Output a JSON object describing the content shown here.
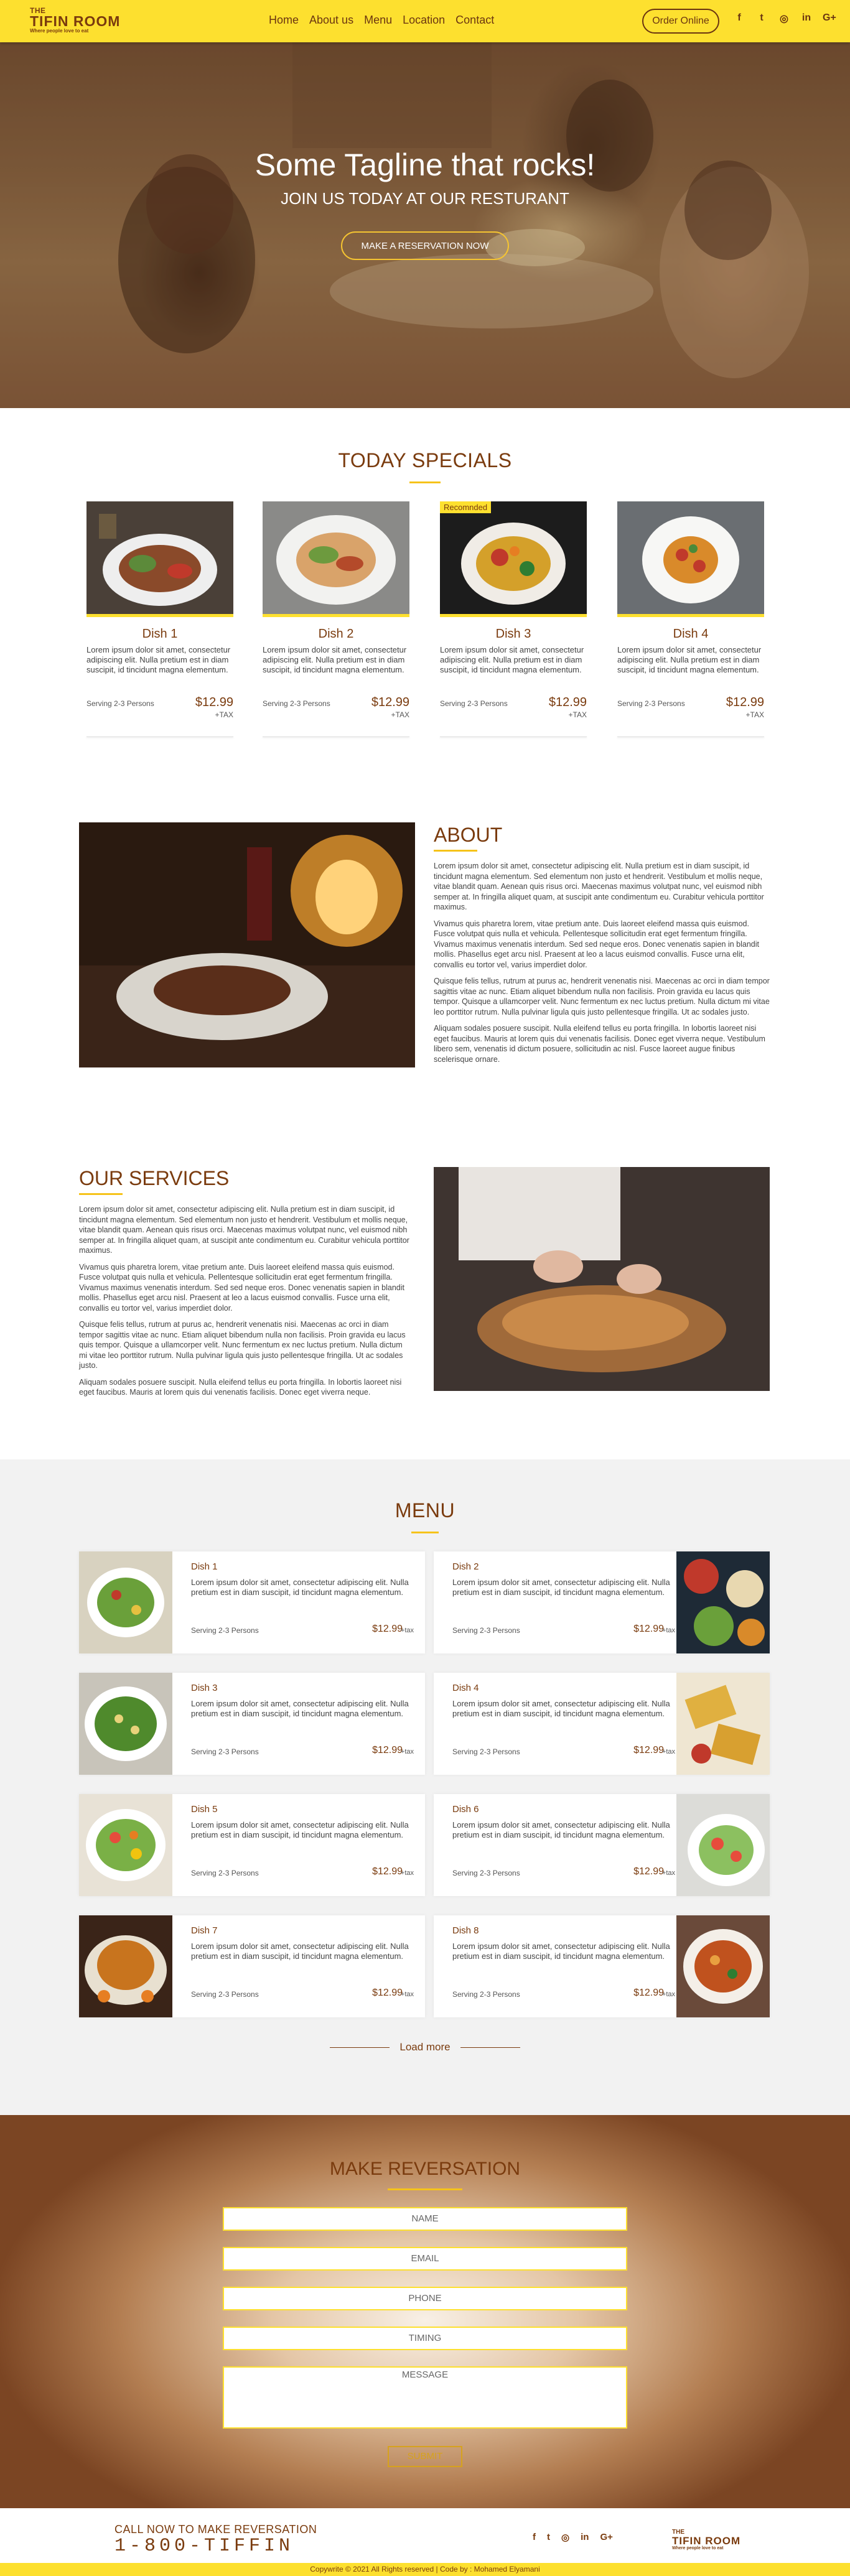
{
  "header": {
    "logo_top": "THE",
    "logo_main": "TIFIN ROOM",
    "logo_tagline": "Where people love to eat",
    "nav": [
      "Home",
      "About us",
      "Menu",
      "Location",
      "Contact"
    ],
    "order_button": "Order Online",
    "socials": [
      "f",
      "t",
      "◎",
      "in",
      "G+"
    ]
  },
  "hero": {
    "tagline": "Some Tagline that rocks!",
    "subline": "JOIN US TODAY AT OUR RESTURANT",
    "button": "MAKE A RESERVATION NOW"
  },
  "specials": {
    "title": "TODAY SPECIALS",
    "items": [
      {
        "name": "Dish 1",
        "desc": "Lorem ipsum dolor sit amet, consectetur adipiscing elit. Nulla pretium est in diam suscipit, id tincidunt magna elementum.",
        "serving": "Serving 2-3 Persons",
        "price": "$12.99",
        "tax": "+TAX"
      },
      {
        "name": "Dish 2",
        "desc": "Lorem ipsum dolor sit amet, consectetur adipiscing elit. Nulla pretium est in diam suscipit, id tincidunt magna elementum.",
        "serving": "Serving 2-3 Persons",
        "price": "$12.99",
        "tax": "+TAX"
      },
      {
        "name": "Dish 3",
        "desc": "Lorem ipsum dolor sit amet, consectetur adipiscing elit. Nulla pretium est in diam suscipit, id tincidunt magna elementum.",
        "serving": "Serving 2-3 Persons",
        "price": "$12.99",
        "tax": "+TAX",
        "badge": "Recomnded"
      },
      {
        "name": "Dish 4",
        "desc": "Lorem ipsum dolor sit amet, consectetur adipiscing elit. Nulla pretium est in diam suscipit, id tincidunt magna elementum.",
        "serving": "Serving 2-3 Persons",
        "price": "$12.99",
        "tax": "+TAX"
      }
    ]
  },
  "about": {
    "title": "ABOUT",
    "paragraphs": [
      "Lorem ipsum dolor sit amet, consectetur adipiscing elit. Nulla pretium est in diam suscipit, id tincidunt magna elementum. Sed elementum non justo et hendrerit. Vestibulum et mollis neque, vitae blandit quam. Aenean quis risus orci. Maecenas maximus volutpat nunc, vel euismod nibh semper at. In fringilla aliquet quam, at suscipit ante condimentum eu. Curabitur vehicula porttitor maximus.",
      "Vivamus quis pharetra lorem, vitae pretium ante. Duis laoreet eleifend massa quis euismod. Fusce volutpat quis nulla et vehicula. Pellentesque sollicitudin erat eget fermentum fringilla. Vivamus maximus venenatis interdum. Sed sed neque eros. Donec venenatis sapien in blandit mollis. Phasellus eget arcu nisl. Praesent at leo a lacus euismod convallis. Fusce urna elit, convallis eu tortor vel, varius imperdiet dolor.",
      "Quisque felis tellus, rutrum at purus ac, hendrerit venenatis nisi. Maecenas ac orci in diam tempor sagittis vitae ac nunc. Etiam aliquet bibendum nulla non facilisis. Proin gravida eu lacus quis tempor. Quisque a ullamcorper velit. Nunc fermentum ex nec luctus pretium. Nulla dictum mi vitae leo porttitor rutrum. Nulla pulvinar ligula quis justo pellentesque fringilla. Ut ac sodales justo.",
      "Aliquam sodales posuere suscipit. Nulla eleifend tellus eu porta fringilla. In lobortis laoreet nisi eget faucibus. Mauris at lorem quis dui venenatis facilisis. Donec eget viverra neque. Vestibulum libero sem, venenatis id dictum posuere, sollicitudin ac nisl. Fusce laoreet augue finibus scelerisque ornare."
    ]
  },
  "services": {
    "title": "OUR SERVICES",
    "paragraphs": [
      "Lorem ipsum dolor sit amet, consectetur adipiscing elit. Nulla pretium est in diam suscipit, id tincidunt magna elementum. Sed elementum non justo et hendrerit. Vestibulum et mollis neque, vitae blandit quam. Aenean quis risus orci. Maecenas maximus volutpat nunc, vel euismod nibh semper at. In fringilla aliquet quam, at suscipit ante condimentum eu. Curabitur vehicula porttitor maximus.",
      "Vivamus quis pharetra lorem, vitae pretium ante. Duis laoreet eleifend massa quis euismod. Fusce volutpat quis nulla et vehicula. Pellentesque sollicitudin erat eget fermentum fringilla. Vivamus maximus venenatis interdum. Sed sed neque eros. Donec venenatis sapien in blandit mollis. Phasellus eget arcu nisl. Praesent at leo a lacus euismod convallis. Fusce urna elit, convallis eu tortor vel, varius imperdiet dolor.",
      "Quisque felis tellus, rutrum at purus ac, hendrerit venenatis nisi. Maecenas ac orci in diam tempor sagittis vitae ac nunc. Etiam aliquet bibendum nulla non facilisis. Proin gravida eu lacus quis tempor. Quisque a ullamcorper velit. Nunc fermentum ex nec luctus pretium. Nulla dictum mi vitae leo porttitor rutrum. Nulla pulvinar ligula quis justo pellentesque fringilla. Ut ac sodales justo.",
      "Aliquam sodales posuere suscipit. Nulla eleifend tellus eu porta fringilla. In lobortis laoreet nisi eget faucibus. Mauris at lorem quis dui venenatis facilisis. Donec eget viverra neque."
    ]
  },
  "menu": {
    "title": "MENU",
    "items": [
      {
        "name": "Dish 1",
        "desc": "Lorem ipsum dolor sit amet, consectetur adipiscing elit. Nulla pretium est in diam suscipit, id tincidunt magna elementum.",
        "serving": "Serving 2-3 Persons",
        "price": "$12.99",
        "tax": "+tax"
      },
      {
        "name": "Dish 2",
        "desc": "Lorem ipsum dolor sit amet, consectetur adipiscing elit. Nulla pretium est in diam suscipit, id tincidunt magna elementum.",
        "serving": "Serving 2-3 Persons",
        "price": "$12.99",
        "tax": "+tax"
      },
      {
        "name": "Dish 3",
        "desc": "Lorem ipsum dolor sit amet, consectetur adipiscing elit. Nulla pretium est in diam suscipit, id tincidunt magna elementum.",
        "serving": "Serving 2-3 Persons",
        "price": "$12.99",
        "tax": "+tax"
      },
      {
        "name": "Dish 4",
        "desc": "Lorem ipsum dolor sit amet, consectetur adipiscing elit. Nulla pretium est in diam suscipit, id tincidunt magna elementum.",
        "serving": "Serving 2-3 Persons",
        "price": "$12.99",
        "tax": "+tax"
      },
      {
        "name": "Dish 5",
        "desc": "Lorem ipsum dolor sit amet, consectetur adipiscing elit. Nulla pretium est in diam suscipit, id tincidunt magna elementum.",
        "serving": "Serving 2-3 Persons",
        "price": "$12.99",
        "tax": "+tax"
      },
      {
        "name": "Dish 6",
        "desc": "Lorem ipsum dolor sit amet, consectetur adipiscing elit. Nulla pretium est in diam suscipit, id tincidunt magna elementum.",
        "serving": "Serving 2-3 Persons",
        "price": "$12.99",
        "tax": "+tax"
      },
      {
        "name": "Dish 7",
        "desc": "Lorem ipsum dolor sit amet, consectetur adipiscing elit. Nulla pretium est in diam suscipit, id tincidunt magna elementum.",
        "serving": "Serving 2-3 Persons",
        "price": "$12.99",
        "tax": "+tax"
      },
      {
        "name": "Dish 8",
        "desc": "Lorem ipsum dolor sit amet, consectetur adipiscing elit. Nulla pretium est in diam suscipit, id tincidunt magna elementum.",
        "serving": "Serving 2-3 Persons",
        "price": "$12.99",
        "tax": "+tax"
      }
    ],
    "load_more": "Load more"
  },
  "reservation": {
    "title": "MAKE REVERSATION",
    "fields": [
      "NAME",
      "EMAIL",
      "PHONE",
      "TIMING",
      "MESSAGE"
    ],
    "submit": "SUBMIT"
  },
  "footer": {
    "call_label": "CALL NOW TO MAKE REVERSATION",
    "phone": "1-800-TIFFIN",
    "socials": [
      "f",
      "t",
      "◎",
      "in",
      "G+"
    ],
    "logo_top": "THE",
    "logo_main": "TIFIN ROOM",
    "logo_tagline": "Where people love to eat",
    "copyright": "Copywrite © 2021 All Rights reserved | Code by : Mohamed Elyamani"
  },
  "colors": {
    "accent_yellow": "#fde02f",
    "brand_brown": "#7a3b0e"
  }
}
